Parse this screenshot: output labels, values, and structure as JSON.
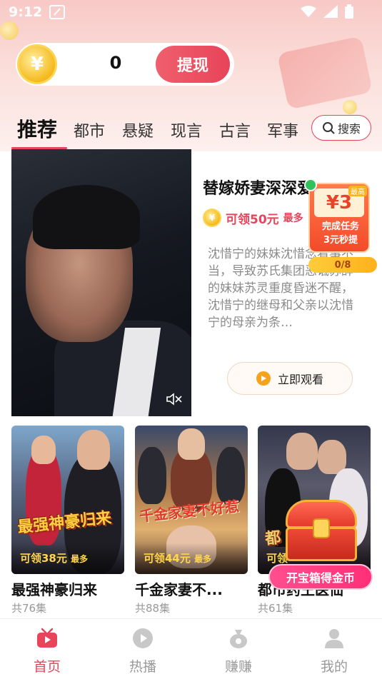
{
  "status_bar": {
    "time": "9:12"
  },
  "wallet": {
    "coin_icon": "yen-coin-icon",
    "coin_symbol": "¥",
    "balance": "0",
    "withdraw_label": "提现"
  },
  "tabs": [
    {
      "label": "推荐",
      "active": true
    },
    {
      "label": "都市",
      "active": false
    },
    {
      "label": "悬疑",
      "active": false
    },
    {
      "label": "现言",
      "active": false
    },
    {
      "label": "古言",
      "active": false
    },
    {
      "label": "军事",
      "active": false
    }
  ],
  "search": {
    "label": "搜索"
  },
  "featured": {
    "title": "替嫁娇妻深深爱",
    "reward": "可领50元",
    "reward_more": "最多",
    "description": "沈惜宁的妹妹沈惜念看事不当，导致苏氏集团恶诋苏辞的妹妹苏灵重度昏迷不醒，沈惜宁的继母和父亲以沈惜宁的母亲为条…",
    "watch_label": "立即观看"
  },
  "task_widget": {
    "badge": "最高",
    "amount": "¥3",
    "line1": "完成任务",
    "line2": "3元秒提",
    "progress": "0/8"
  },
  "dramas": [
    {
      "title": "最强神豪归来",
      "episodes": "共76集",
      "reward": "可领38元",
      "reward_more": "最多",
      "poster_text": "最强神豪归来"
    },
    {
      "title": "千金家妻不...",
      "episodes": "共88集",
      "reward": "可领44元",
      "reward_more": "最多",
      "poster_text": "千金家妻不好惹"
    },
    {
      "title": "都市药王医仙",
      "episodes": "共61集",
      "reward": "可领",
      "reward_more": "",
      "poster_text": "都"
    }
  ],
  "treasure": {
    "label": "开宝箱得金币"
  },
  "nav": [
    {
      "label": "首页",
      "icon": "tv-icon",
      "active": true
    },
    {
      "label": "热播",
      "icon": "play-circle-icon",
      "active": false
    },
    {
      "label": "赚赚",
      "icon": "money-bag-icon",
      "active": false
    },
    {
      "label": "我的",
      "icon": "person-icon",
      "active": false
    }
  ],
  "colors": {
    "accent": "#e8445a",
    "gold": "#f5b91d",
    "reward_text": "#ffd54a"
  }
}
